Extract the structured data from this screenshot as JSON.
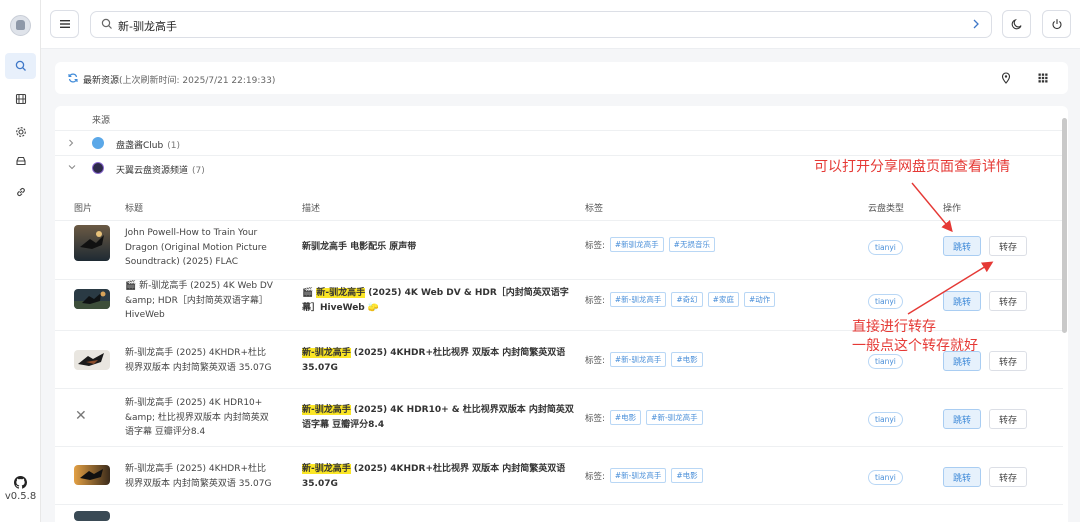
{
  "app": {
    "version": "v0.5.8"
  },
  "search": {
    "query": "新-驯龙高手"
  },
  "refresh": {
    "title": "最新资源",
    "subtitle": "(上次刷新时间:  2025/7/21 22:19:33)"
  },
  "sources": {
    "header": "来源",
    "items": [
      {
        "name": "盘盏酱Club",
        "count": "(1)",
        "color": "#5ba8e8"
      },
      {
        "name": "天翼云盘资源频道",
        "count": "(7)",
        "color": "#2d2a4a"
      }
    ]
  },
  "table": {
    "columns": [
      "图片",
      "标题",
      "描述",
      "标签",
      "云盘类型",
      "操作"
    ],
    "tag_prefix": "标签:",
    "jump_label": "跳转",
    "save_label": "转存",
    "rows": [
      {
        "title": "John Powell-How to Train Your Dragon (Original Motion Picture Soundtrack) (2025) FLAC",
        "desc_hl": "",
        "desc_rest": "新驯龙高手 电影配乐 原声带",
        "tags": [
          "#新驯龙高手",
          "#无损音乐"
        ],
        "cloud": "tianyi",
        "thumb": "dragon"
      },
      {
        "title": "🎬 新-驯龙高手 (2025) 4K Web DV &amp; HDR［内封简英双语字幕］HiveWeb",
        "desc_pre": "🎬 ",
        "desc_hl": "新-驯龙高手",
        "desc_rest": " (2025) 4K Web DV & HDR［内封简英双语字幕］HiveWeb 🧽",
        "tags": [
          "#新-驯龙高手",
          "#奇幻",
          "#家庭",
          "#动作"
        ],
        "cloud": "tianyi",
        "thumb": "dragon2"
      },
      {
        "title": "新-驯龙高手 (2025) 4KHDR+杜比视界双版本 内封简繁英双语 35.07G",
        "desc_hl": "新-驯龙高手",
        "desc_rest": " (2025) 4KHDR+杜比视界 双版本 内封简繁英双语 35.07G",
        "tags": [
          "#新-驯龙高手",
          "#电影"
        ],
        "cloud": "tianyi",
        "thumb": "dragon3"
      },
      {
        "title": "新-驯龙高手 (2025) 4K HDR10+ &amp; 杜比视界双版本 内封简英双语字幕 豆瓣评分8.4",
        "desc_hl": "新-驯龙高手",
        "desc_rest": " (2025) 4K HDR10+ & 杜比视界双版本 内封简英双语字幕 豆瓣评分8.4",
        "tags": [
          "#电影",
          "#新-驯龙高手"
        ],
        "cloud": "tianyi",
        "thumb": "none"
      },
      {
        "title": "新-驯龙高手 (2025) 4KHDR+杜比视界双版本 内封简繁英双语 35.07G",
        "desc_hl": "新-驯龙高手",
        "desc_rest": " (2025) 4KHDR+杜比视界 双版本 内封简繁英双语 35.07G",
        "tags": [
          "#新-驯龙高手",
          "#电影"
        ],
        "cloud": "tianyi",
        "thumb": "dragon4"
      }
    ]
  },
  "annotations": {
    "top": "可以打开分享网盘页面查看详情",
    "bottom_line1": "直接进行转存",
    "bottom_line2": "一般点这个转存就好"
  }
}
